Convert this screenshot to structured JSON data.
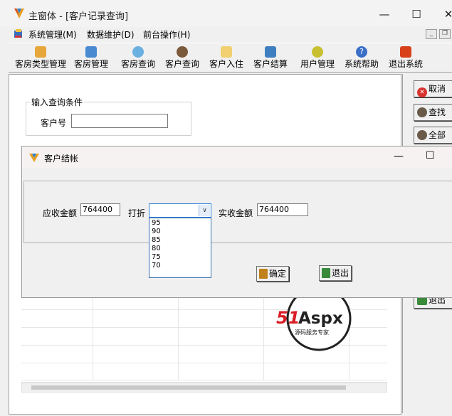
{
  "window": {
    "title": "主窗体 - [客户记录查询]"
  },
  "menubar": {
    "items": [
      "系统管理(M)",
      "数据维护(D)",
      "前台操作(H)"
    ]
  },
  "toolbar": {
    "buttons": [
      {
        "label": "客房类型管理",
        "icon": "house-icon"
      },
      {
        "label": "客房管理",
        "icon": "book-icon"
      },
      {
        "label": "客房查询",
        "icon": "magnifier-icon"
      },
      {
        "label": "客户查询",
        "icon": "people-search-icon"
      },
      {
        "label": "客户入住",
        "icon": "clipboard-icon"
      },
      {
        "label": "客户结算",
        "icon": "calculator-icon"
      },
      {
        "label": "用户管理",
        "icon": "users-icon"
      },
      {
        "label": "系统帮助",
        "icon": "help-icon"
      },
      {
        "label": "退出系统",
        "icon": "power-icon"
      }
    ]
  },
  "query": {
    "legend": "输入查询条件",
    "customer_no_label": "客户号",
    "customer_no_value": ""
  },
  "side": {
    "cancel": "取消",
    "find": "查找",
    "all": "全部",
    "exit": "退出"
  },
  "dialog": {
    "title": "客户结帐",
    "receivable_label": "应收金额",
    "receivable_value": "764400",
    "discount_label": "打折",
    "discount_value": "",
    "discount_options": [
      "95",
      "90",
      "85",
      "80",
      "75",
      "70"
    ],
    "actual_label": "实收金额",
    "actual_value": "764400",
    "ok": "确定",
    "exit": "退出"
  },
  "watermark": {
    "brand": "51Aspx",
    "tagline": "源码服务专家"
  },
  "colors": {
    "accent": "#2a7fd6",
    "danger": "#d9322c",
    "brand_red": "#d81e25",
    "brand_green": "#3aa03a"
  }
}
